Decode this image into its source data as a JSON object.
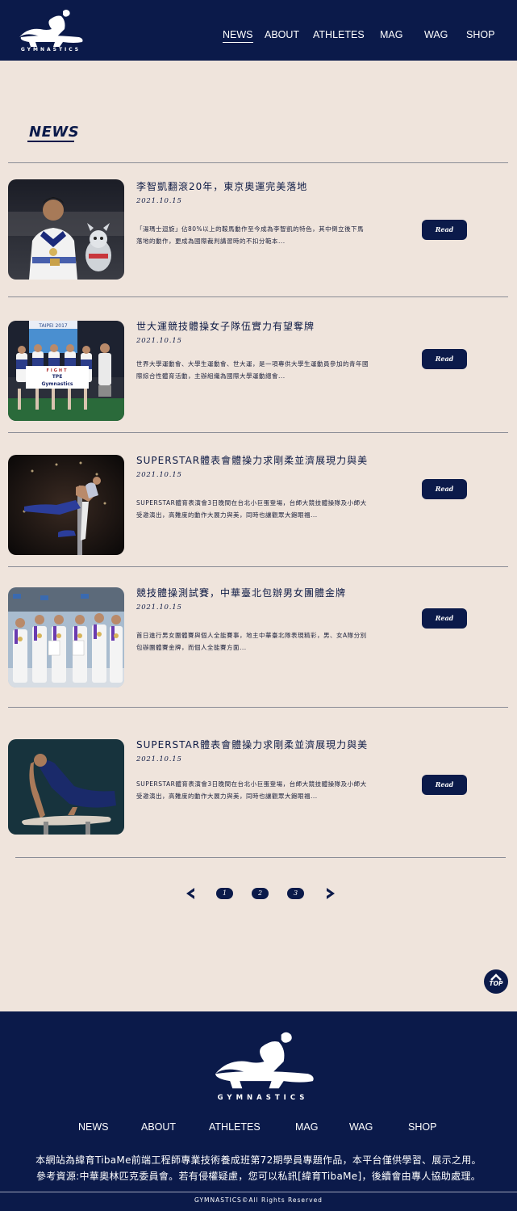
{
  "brand": {
    "name": "GYMNASTICS"
  },
  "nav": {
    "items": [
      {
        "label": "NEWS"
      },
      {
        "label": "ABOUT"
      },
      {
        "label": "ATHLETES"
      },
      {
        "label": "MAG"
      },
      {
        "label": "WAG"
      },
      {
        "label": "SHOP"
      }
    ]
  },
  "page": {
    "title": "NEWS"
  },
  "articles": [
    {
      "title": "李智凱翻滾20年，東京奧運完美落地",
      "date": "2021.10.15",
      "desc": "「湯瑪士迴旋」佔80%以上的鞍馬動作至今成為李智凱的特色，其中倒立後下馬落地的動作，更成為國際裁判講習時的不扣分範本...",
      "button": "Read"
    },
    {
      "title": "世大運競技體操女子隊伍實力有望奪牌",
      "date": "2021.10.15",
      "desc": "世界大學運動會、大學生運動會、世大運，是一項專供大學生運動員參加的青年國際綜合性體育活動，主辦組織為國際大學運動總會...",
      "button": "Read"
    },
    {
      "title": "SUPERSTAR體表會體操力求剛柔並濟展現力與美",
      "date": "2021.10.15",
      "desc": "SUPERSTAR體育表演會3日晚間在台北小巨蛋登場，台師大競技體操隊及小師大受邀演出，高難度的動作大展力與美，同時也讓觀眾大飽眼福...",
      "button": "Read"
    },
    {
      "title": "競技體操測試賽，中華臺北包辦男女團體金牌",
      "date": "2021.10.15",
      "desc": "首日進行男女團體賽與個人全能賽事，地主中華臺北隊表現精彩，男、女A隊分別包辦團體賽金牌，而個人全能賽方面...",
      "button": "Read"
    },
    {
      "title": "SUPERSTAR體表會體操力求剛柔並濟展現力與美",
      "date": "2021.10.15",
      "desc": "SUPERSTAR體育表演會3日晚間在台北小巨蛋登場，台師大競技體操隊及小師大受邀演出，高難度的動作大展力與美，同時也讓觀眾大飽眼福...",
      "button": "Read"
    }
  ],
  "banner": {
    "logo_line1": "TAIPEI 2017",
    "line1": "FIGHT",
    "line2": "TPE",
    "line3": "Gymnastics"
  },
  "pagination": {
    "pages": [
      "1",
      "2",
      "3"
    ]
  },
  "top_button": {
    "label": "TOP"
  },
  "footer": {
    "nav": [
      "NEWS",
      "ABOUT",
      "ATHLETES",
      "MAG",
      "WAG",
      "SHOP"
    ],
    "note_line1": "本網站為緯育TibaMe前端工程師專業技術養成班第72期學員專題作品，本平台僅供學習、展示之用。",
    "note_line2": "參考資源:中華奧林匹克委員會。若有侵權疑慮，您可以私訊[緯育TibaMe]，後續會由專人協助處理。",
    "copyright": "GYMNASTICS©All Rights Reserved"
  },
  "colors": {
    "navy": "#0b1a4a",
    "background": "#efe4dc"
  },
  "icons": [
    "gymnast-logo",
    "prev-arrow-icon",
    "next-arrow-icon",
    "top-arrow-icon"
  ]
}
